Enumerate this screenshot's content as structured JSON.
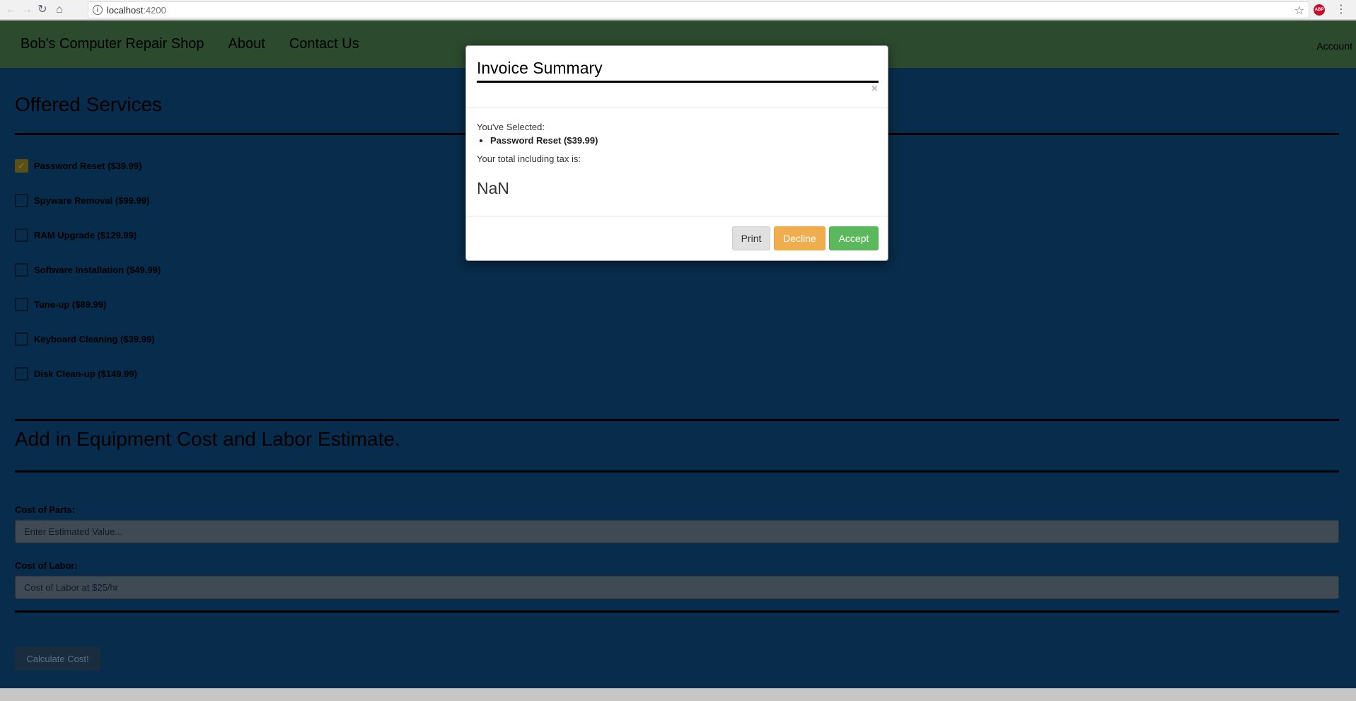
{
  "browser": {
    "url_host": "localhost",
    "url_port": ":4200",
    "adblock_label": "ABP"
  },
  "navbar": {
    "brand": "Bob's Computer Repair Shop",
    "links": [
      "About",
      "Contact Us"
    ],
    "account": "Account"
  },
  "services": {
    "heading": "Offered Services",
    "items": [
      {
        "label": "Password Reset ($39.99)",
        "checked": true
      },
      {
        "label": "Spyware Removal ($99.99)",
        "checked": false
      },
      {
        "label": "RAM Upgrade ($129.99)",
        "checked": false
      },
      {
        "label": "Software Installation ($49.99)",
        "checked": false
      },
      {
        "label": "Tune-up ($89.99)",
        "checked": false
      },
      {
        "label": "Keyboard Cleaning ($39.99)",
        "checked": false
      },
      {
        "label": "Disk Clean-up ($149.99)",
        "checked": false
      }
    ]
  },
  "estimate": {
    "heading": "Add in Equipment Cost and Labor Estimate.",
    "parts_label": "Cost of Parts:",
    "parts_placeholder": "Enter Estimated Value...",
    "labor_label": "Cost of Labor:",
    "labor_placeholder": "Cost of Labor at $25/hr",
    "calculate_label": "Calculate Cost!"
  },
  "modal": {
    "title": "Invoice Summary",
    "close": "×",
    "selected_label": "You've Selected:",
    "selected_items": [
      "Password Reset ($39.99)"
    ],
    "total_label": "Your total including tax is:",
    "total_value": "NaN",
    "print_label": "Print",
    "decline_label": "Decline",
    "accept_label": "Accept"
  },
  "colors": {
    "navbar_bg": "#2b4a2e",
    "page_bg": "#082c4b",
    "decline": "#f0ad4e",
    "accept": "#5cb85c"
  }
}
